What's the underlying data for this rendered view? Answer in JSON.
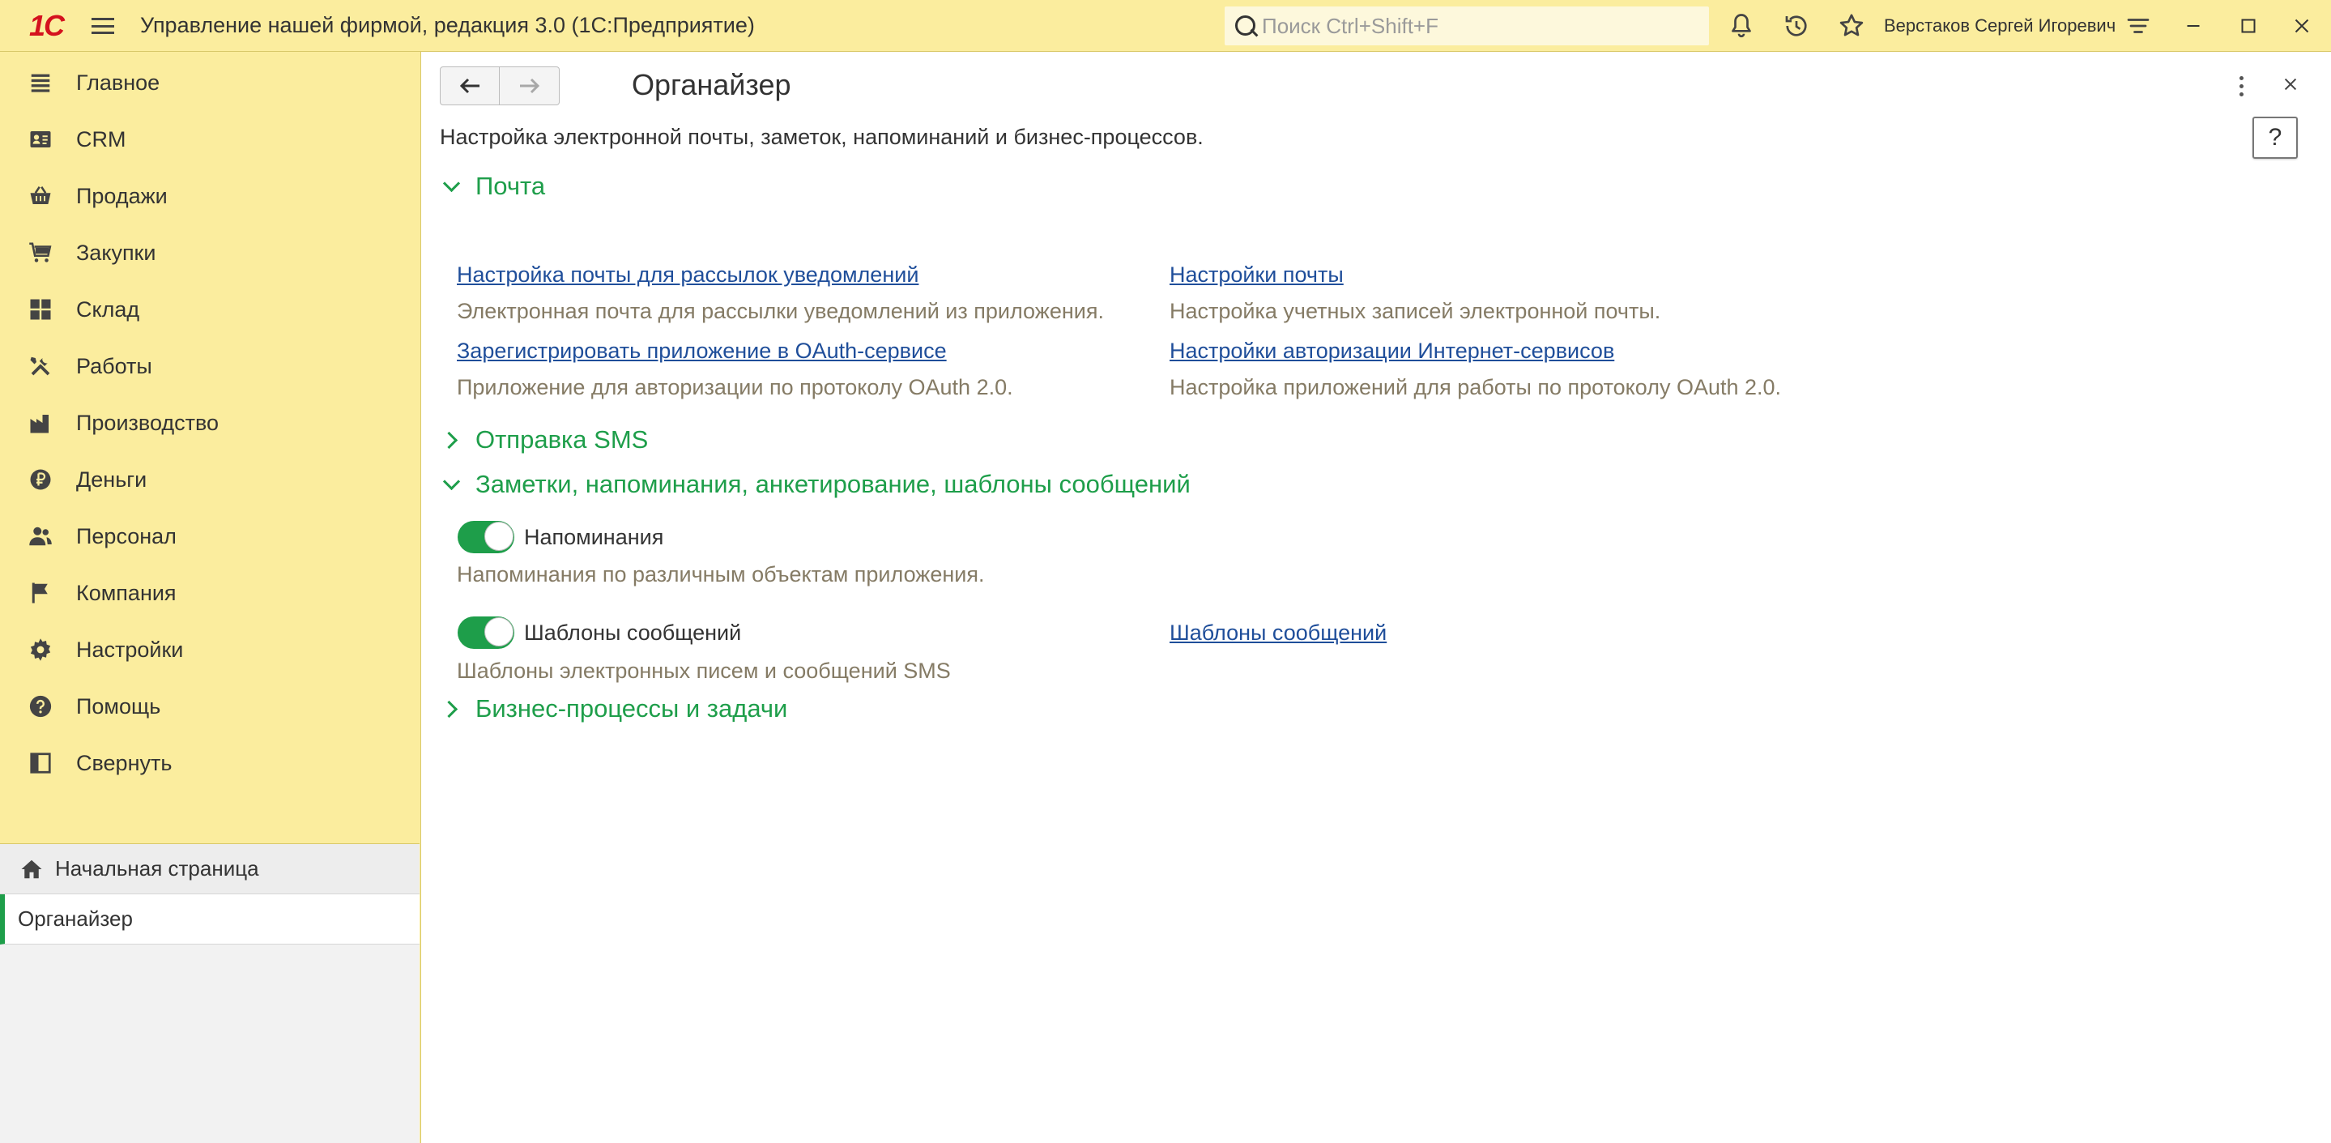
{
  "app": {
    "logo_text": "1С",
    "title": "Управление нашей фирмой, редакция 3.0  (1С:Предприятие)",
    "search_placeholder": "Поиск Ctrl+Shift+F",
    "user_name": "Верстаков Сергей Игоревич",
    "accent_color": "#1e9e4a",
    "sidebar_color": "#fbed9e",
    "link_color": "#1f4e9a"
  },
  "sidebar": {
    "items": [
      {
        "label": "Главное",
        "icon": "list-icon"
      },
      {
        "label": "CRM",
        "icon": "contact-card-icon"
      },
      {
        "label": "Продажи",
        "icon": "basket-icon"
      },
      {
        "label": "Закупки",
        "icon": "cart-icon"
      },
      {
        "label": "Склад",
        "icon": "warehouse-grid-icon"
      },
      {
        "label": "Работы",
        "icon": "tools-icon"
      },
      {
        "label": "Производство",
        "icon": "factory-icon"
      },
      {
        "label": "Деньги",
        "icon": "ruble-icon"
      },
      {
        "label": "Персонал",
        "icon": "people-icon"
      },
      {
        "label": "Компания",
        "icon": "flag-icon"
      },
      {
        "label": "Настройки",
        "icon": "gear-icon"
      },
      {
        "label": "Помощь",
        "icon": "help-icon"
      },
      {
        "label": "Свернуть",
        "icon": "collapse-panel-icon"
      }
    ],
    "open_windows": {
      "home": "Начальная страница",
      "current": "Органайзер"
    }
  },
  "main": {
    "title": "Органайзер",
    "help_label": "?",
    "description": "Настройка электронной почты, заметок, напоминаний и бизнес-процессов.",
    "groups": {
      "mail": {
        "label": "Почта",
        "expanded": true,
        "links": [
          {
            "label": "Настройка почты для рассылок уведомлений",
            "hint": "Электронная почта для рассылки уведомлений из приложения."
          },
          {
            "label": "Настройки почты",
            "hint": "Настройка учетных записей электронной почты."
          },
          {
            "label": "Зарегистрировать приложение в OAuth-сервисе",
            "hint": "Приложение для авторизации по протоколу OAuth 2.0."
          },
          {
            "label": "Настройки авторизации Интернет-сервисов",
            "hint": "Настройка приложений для работы по протоколу OAuth 2.0."
          }
        ]
      },
      "sms": {
        "label": "Отправка SMS",
        "expanded": false
      },
      "notes": {
        "label": "Заметки, напоминания, анкетирование, шаблоны сообщений",
        "expanded": true,
        "reminders": {
          "label": "Напоминания",
          "checked": true,
          "hint": "Напоминания по различным объектам приложения."
        },
        "templates": {
          "label": "Шаблоны сообщений",
          "checked": true,
          "hint": "Шаблоны электронных писем и сообщений SMS",
          "link": "Шаблоны сообщений"
        }
      },
      "bp": {
        "label": "Бизнес-процессы и задачи",
        "expanded": false
      }
    }
  }
}
